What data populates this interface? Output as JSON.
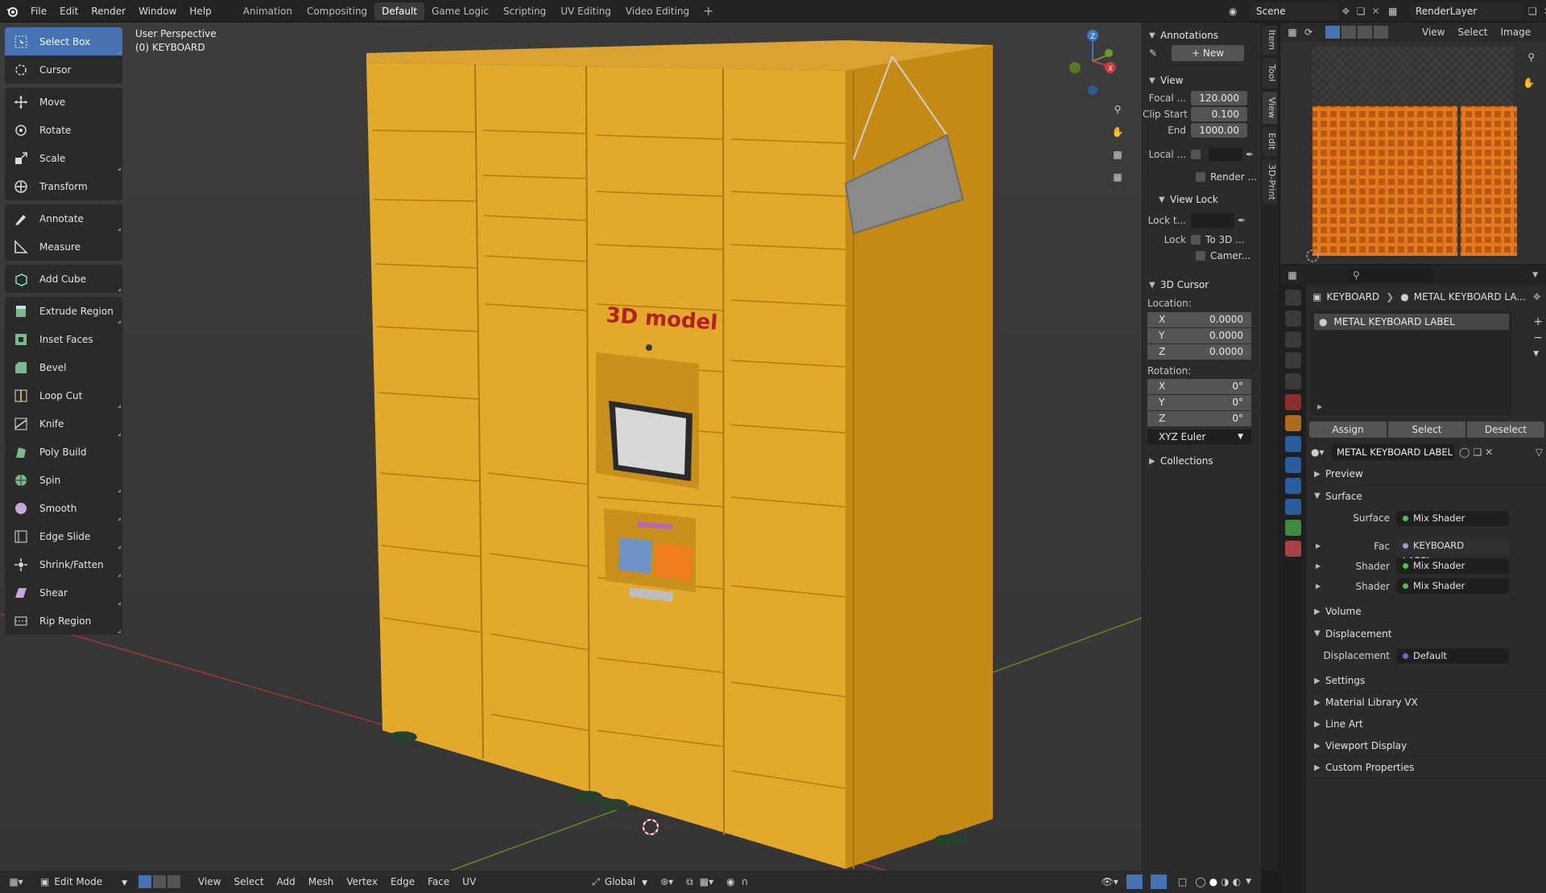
{
  "menu": [
    "File",
    "Edit",
    "Render",
    "Window",
    "Help"
  ],
  "workspaces": [
    "Animation",
    "Compositing",
    "Default",
    "Game Logic",
    "Scripting",
    "UV Editing",
    "Video Editing"
  ],
  "active_workspace": "Default",
  "scene_name": "Scene",
  "render_layer": "RenderLayer",
  "viewport": {
    "perspective_label": "User Perspective",
    "object_label": "(0) KEYBOARD",
    "model_text": "3D model"
  },
  "tools": [
    {
      "label": "Select Box",
      "icon": "select-box-icon"
    },
    {
      "label": "Cursor",
      "icon": "cursor-icon"
    },
    {
      "label": "Move",
      "icon": "move-icon"
    },
    {
      "label": "Rotate",
      "icon": "rotate-icon"
    },
    {
      "label": "Scale",
      "icon": "scale-icon"
    },
    {
      "label": "Transform",
      "icon": "transform-icon"
    },
    {
      "label": "Annotate",
      "icon": "annotate-icon"
    },
    {
      "label": "Measure",
      "icon": "measure-icon"
    },
    {
      "label": "Add Cube",
      "icon": "add-cube-icon"
    },
    {
      "label": "Extrude Region",
      "icon": "extrude-icon"
    },
    {
      "label": "Inset Faces",
      "icon": "inset-icon"
    },
    {
      "label": "Bevel",
      "icon": "bevel-icon"
    },
    {
      "label": "Loop Cut",
      "icon": "loop-cut-icon"
    },
    {
      "label": "Knife",
      "icon": "knife-icon"
    },
    {
      "label": "Poly Build",
      "icon": "poly-build-icon"
    },
    {
      "label": "Spin",
      "icon": "spin-icon"
    },
    {
      "label": "Smooth",
      "icon": "smooth-icon"
    },
    {
      "label": "Edge Slide",
      "icon": "edge-slide-icon"
    },
    {
      "label": "Shrink/Fatten",
      "icon": "shrink-fatten-icon"
    },
    {
      "label": "Shear",
      "icon": "shear-icon"
    },
    {
      "label": "Rip Region",
      "icon": "rip-icon"
    }
  ],
  "npanel": {
    "annotations_title": "Annotations",
    "new_label": "New",
    "view_title": "View",
    "focal_label": "Focal ...",
    "focal_value": "120.000",
    "clip_start_label": "Clip Start",
    "clip_start_value": "0.100",
    "clip_end_label": "End",
    "clip_end_value": "1000.00",
    "local_label": "Local ...",
    "render_label": "Render ...",
    "view_lock_title": "View Lock",
    "lock_to_label": "Lock t...",
    "lock_label": "Lock",
    "to3d_label": "To 3D ...",
    "camera_label": "Camer...",
    "cursor_title": "3D Cursor",
    "location_label": "Location:",
    "rotation_label": "Rotation:",
    "loc": [
      {
        "axis": "X",
        "value": "0.0000"
      },
      {
        "axis": "Y",
        "value": "0.0000"
      },
      {
        "axis": "Z",
        "value": "0.0000"
      }
    ],
    "rot": [
      {
        "axis": "X",
        "value": "0°"
      },
      {
        "axis": "Y",
        "value": "0°"
      },
      {
        "axis": "Z",
        "value": "0°"
      }
    ],
    "rotation_mode": "XYZ Euler",
    "collections_title": "Collections",
    "tabs": [
      "Item",
      "Tool",
      "View",
      "Edit",
      "3D-Print"
    ]
  },
  "uv_header": {
    "view": "View",
    "select": "Select",
    "image": "Image"
  },
  "properties": {
    "breadcrumb_object": "KEYBOARD",
    "breadcrumb_material": "METAL KEYBOARD LA...",
    "slot_name": "METAL KEYBOARD LABEL",
    "assign": "Assign",
    "select": "Select",
    "deselect": "Deselect",
    "material_name": "METAL KEYBOARD LABEL",
    "sections": {
      "preview": "Preview",
      "surface": "Surface",
      "volume": "Volume",
      "displacement": "Displacement",
      "settings": "Settings",
      "material_library": "Material Library VX",
      "line_art": "Line Art",
      "viewport_display": "Viewport Display",
      "custom_properties": "Custom Properties"
    },
    "surface_label": "Surface",
    "surface_value": "Mix Shader",
    "fac_label": "Fac",
    "fac_value": "KEYBOARD LABEL.png",
    "shader1_label": "Shader",
    "shader1_value": "Mix Shader",
    "shader2_label": "Shader",
    "shader2_value": "Mix Shader",
    "displacement_label": "Displacement",
    "displacement_value": "Default"
  },
  "bottombar": {
    "mode": "Edit Mode",
    "menus": [
      "View",
      "Select",
      "Add",
      "Mesh",
      "Vertex",
      "Edge",
      "Face",
      "UV"
    ],
    "orientation": "Global"
  },
  "colors": {
    "accent": "#4772b3",
    "locker": "#e0a92b",
    "x_axis": "#c83b3b",
    "y_axis": "#6e9e2a",
    "z_axis": "#3b76c8"
  }
}
